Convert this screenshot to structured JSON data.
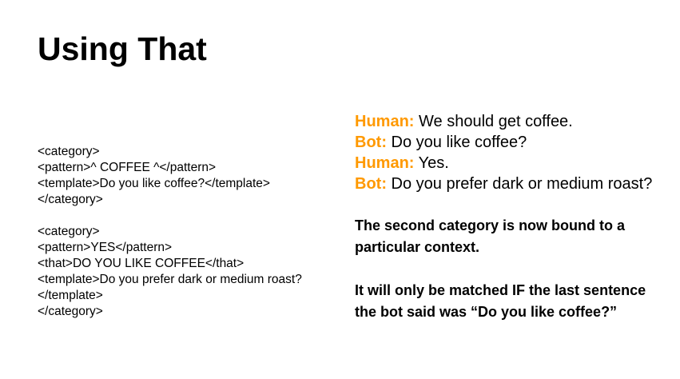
{
  "slide": {
    "title": "Using That"
  },
  "code": {
    "groups": [
      {
        "lines": [
          "<category>",
          "<pattern>^ COFFEE ^</pattern>",
          "<template>Do you like coffee?</template>",
          "</category>"
        ]
      },
      {
        "lines": [
          "<category>",
          "<pattern>YES</pattern>",
          "<that>DO YOU LIKE COFFEE</that>",
          "<template>Do you prefer dark or medium roast?</template>",
          "</category>"
        ]
      }
    ]
  },
  "dialogue": [
    {
      "speaker": "Human:",
      "text": "We should get coffee."
    },
    {
      "speaker": "Bot:",
      "text": "Do you like coffee?"
    },
    {
      "speaker": "Human:",
      "text": "Yes."
    },
    {
      "speaker": "Bot:",
      "text": "Do you prefer dark or medium roast?"
    }
  ],
  "notes": [
    "The second category is now bound to a particular context.",
    "It will only be matched IF the last sentence the bot said was “Do you like coffee?”"
  ],
  "colors": {
    "speaker_accent": "#ff9900",
    "text": "#000000",
    "background": "#ffffff"
  }
}
